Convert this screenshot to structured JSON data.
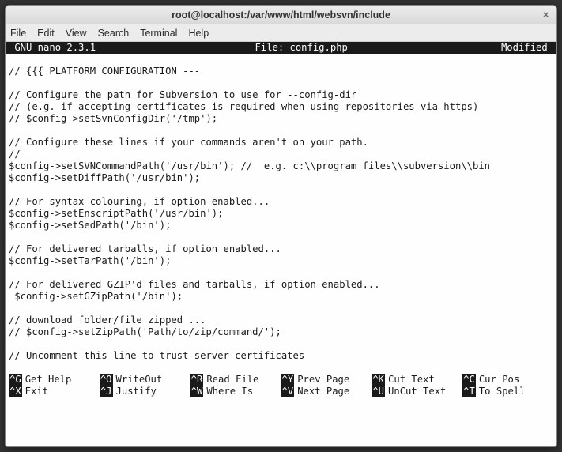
{
  "window": {
    "title": "root@localhost:/var/www/html/websvn/include",
    "close_glyph": "×"
  },
  "menubar": {
    "items": [
      "File",
      "Edit",
      "View",
      "Search",
      "Terminal",
      "Help"
    ]
  },
  "nano": {
    "status_left": " GNU nano 2.3.1 ",
    "status_center": "File: config.php",
    "status_right": "Modified "
  },
  "content_lines": [
    "",
    "// {{{ PLATFORM CONFIGURATION ---",
    "",
    "// Configure the path for Subversion to use for --config-dir",
    "// (e.g. if accepting certificates is required when using repositories via https)",
    "// $config->setSvnConfigDir('/tmp');",
    "",
    "// Configure these lines if your commands aren't on your path.",
    "//",
    "$config->setSVNCommandPath('/usr/bin'); //  e.g. c:\\\\program files\\\\subversion\\\\bin",
    "$config->setDiffPath('/usr/bin');",
    "",
    "// For syntax colouring, if option enabled...",
    "$config->setEnscriptPath('/usr/bin');",
    "$config->setSedPath('/bin');",
    "",
    "// For delivered tarballs, if option enabled...",
    "$config->setTarPath('/bin');",
    "",
    "// For delivered GZIP'd files and tarballs, if option enabled...",
    " $config->setGZipPath('/bin');",
    "",
    "// download folder/file zipped ...",
    "// $config->setZipPath('Path/to/zip/command/');",
    "",
    "// Uncomment this line to trust server certificates",
    ""
  ],
  "shortcuts_row1": [
    {
      "key": "^G",
      "label": "Get Help"
    },
    {
      "key": "^O",
      "label": "WriteOut"
    },
    {
      "key": "^R",
      "label": "Read File"
    },
    {
      "key": "^Y",
      "label": "Prev Page"
    },
    {
      "key": "^K",
      "label": "Cut Text"
    },
    {
      "key": "^C",
      "label": "Cur Pos"
    }
  ],
  "shortcuts_row2": [
    {
      "key": "^X",
      "label": "Exit"
    },
    {
      "key": "^J",
      "label": "Justify"
    },
    {
      "key": "^W",
      "label": "Where Is"
    },
    {
      "key": "^V",
      "label": "Next Page"
    },
    {
      "key": "^U",
      "label": "UnCut Text"
    },
    {
      "key": "^T",
      "label": "To Spell"
    }
  ]
}
